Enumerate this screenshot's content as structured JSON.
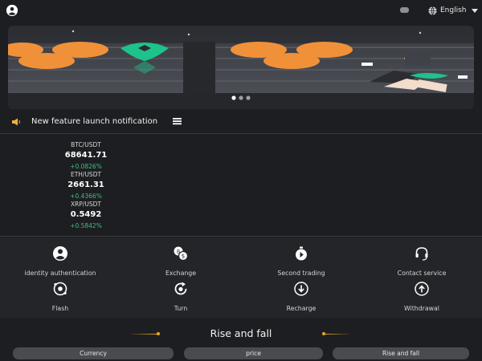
{
  "header": {
    "language": "English"
  },
  "notice": {
    "text": "New feature launch notification"
  },
  "tickers": [
    {
      "pair": "BTC/USDT",
      "price": "68641.71",
      "change": "+0.0826%"
    },
    {
      "pair": "ETH/USDT",
      "price": "2661.31",
      "change": "+0.4366%"
    },
    {
      "pair": "XRP/USDT",
      "price": "0.5492",
      "change": "+0.5842%"
    }
  ],
  "features": [
    {
      "label": "identity authentication",
      "icon": "user-icon"
    },
    {
      "label": "Exchange",
      "icon": "exchange-icon"
    },
    {
      "label": "Second trading",
      "icon": "stopwatch-icon"
    },
    {
      "label": "Contact service",
      "icon": "headset-icon"
    },
    {
      "label": "Flash",
      "icon": "flash-icon"
    },
    {
      "label": "Turn",
      "icon": "turn-icon"
    },
    {
      "label": "Recharge",
      "icon": "download-icon"
    },
    {
      "label": "Withdrawal",
      "icon": "upload-icon"
    }
  ],
  "market": {
    "title": "Rise and fall",
    "columns": [
      "Currency",
      "price",
      "Rise and fall"
    ]
  },
  "colors": {
    "background": "#1d1e21",
    "up": "#3fbf7f",
    "accent_coin": "#f0913a",
    "brand_green": "#1ec28b"
  }
}
